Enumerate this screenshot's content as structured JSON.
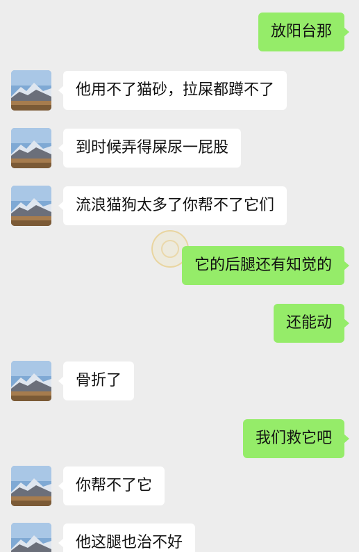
{
  "conversation": {
    "messages": [
      {
        "side": "out",
        "text": "放阳台那"
      },
      {
        "side": "in",
        "text": "他用不了猫砂，拉屎都蹲不了",
        "avatar": "mountain-landscape-avatar"
      },
      {
        "side": "in",
        "text": "到时候弄得屎尿一屁股",
        "avatar": "mountain-landscape-avatar"
      },
      {
        "side": "in",
        "text": "流浪猫狗太多了你帮不了它们",
        "avatar": "mountain-landscape-avatar"
      },
      {
        "side": "out",
        "text": "它的后腿还有知觉的"
      },
      {
        "side": "out",
        "text": "还能动"
      },
      {
        "side": "in",
        "text": "骨折了",
        "avatar": "mountain-landscape-avatar"
      },
      {
        "side": "out",
        "text": "我们救它吧"
      },
      {
        "side": "in",
        "text": "你帮不了它",
        "avatar": "mountain-landscape-avatar"
      },
      {
        "side": "in",
        "text": "他这腿也治不好",
        "avatar": "mountain-landscape-avatar"
      }
    ]
  },
  "colors": {
    "background": "#ededed",
    "outgoing_bubble": "#95ec69",
    "incoming_bubble": "#ffffff",
    "text": "#111111"
  },
  "watermark_icon": "emblem-watermark-icon"
}
